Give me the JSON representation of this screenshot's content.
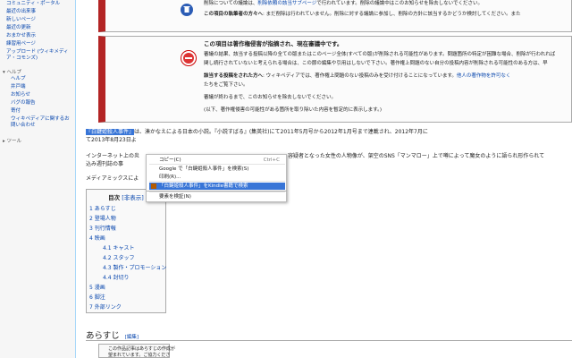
{
  "sidebar": {
    "items": [
      {
        "label": "コミュニティ・ポータル"
      },
      {
        "label": "最近の出来事"
      },
      {
        "label": "新しいページ"
      },
      {
        "label": "最近の更新"
      },
      {
        "label": "おまかせ表示"
      },
      {
        "label": "練習用ページ"
      },
      {
        "label": "アップロード (ウィキメディア・コモンズ)"
      }
    ],
    "help_heading": "ヘルプ",
    "help_items": [
      {
        "label": "ヘルプ"
      },
      {
        "label": "井戸端"
      },
      {
        "label": "お知らせ"
      },
      {
        "label": "バグの報告"
      },
      {
        "label": "寄付"
      },
      {
        "label": "ウィキペディアに関するお問い合わせ"
      }
    ],
    "tools_heading": "ツール"
  },
  "notice_top": {
    "line1a": "削除についての議論は、",
    "line1b": "削除依頼の該当サブページ",
    "line1c": "で行われています。削除の議論中はこのお知らせを除去しないでください。",
    "line2a": "この項目の執筆者の方々へ",
    "line2b": ": まだ削除は行われていません。削除に対する議論に参加し、削除の方針に該当するかどうか検討してください。また"
  },
  "notice_main": {
    "title": "この項目は著作権侵害が指摘され、現在審議中です。",
    "body1": "審議の結果、該当する投稿以降の全ての版またはこのページ全体(すべての版)が削除される可能性があります。問題箇所の特定が困難な場合、削除が行われれば",
    "body2": "関し続行されていないと考えられる場合は、この節の編集や引用はしないで下さい。著作権上問題のない自分の投稿内容が削除される可能性のある方は、早",
    "body3a": "該当する投稿をされた方へ",
    "body3b": ": ウィキペディアでは、著作権上問題のない投稿のみを受け付けることになっています。",
    "body3c": "他人の著作物を許可なく",
    "body4": "たちをご覧下さい。",
    "body5": "審議が終わるまで、このお知らせを除去しないでください。",
    "body6": "(以下、著作権侵害の可能性がある箇所を取り除いた内容を暫定的に表示します。)"
  },
  "article": {
    "selected": "『白鍵姫殺人事件』",
    "lead_tail": "は、湊かなえによる日本の小説。『小説すばる』(集英社)にて2011年5月号から2012年1月号まで連載され、2012年7月に",
    "line2": "て2013年8月23日よ",
    "line3a": "インターネット上の炎",
    "line3b": "容疑者となった女性の人物像が、架空のSNS「マンマロー」上で噂によって魔女のように語られ形作られて",
    "line4": "込み週刊誌の事",
    "line5": "メディアミックスによ"
  },
  "toc": {
    "title": "目次",
    "toggle": "[非表示]",
    "items": [
      {
        "label": "1 あらすじ"
      },
      {
        "label": "2 登場人物"
      },
      {
        "label": "3 刊行情報"
      },
      {
        "label": "4 映画"
      },
      {
        "label": "4.1 キャスト"
      },
      {
        "label": "4.2 スタッフ"
      },
      {
        "label": "4.3 製作・プロモーション"
      },
      {
        "label": "4.4 封切り"
      },
      {
        "label": "5 漫画"
      },
      {
        "label": "6 脚注"
      },
      {
        "label": "7 外部リンク"
      }
    ]
  },
  "section": {
    "heading": "あらすじ",
    "edit": "[編集]",
    "stub1": "この作品記事はあらすじの作成が",
    "stub2": "望まれています。ご協力くださ"
  },
  "context_menu": {
    "copy": "コピー(C)",
    "copy_shortcut": "Ctrl+C",
    "google_search": "Google で「白鍵姫殺人事件」を検索(S)",
    "print": "印刷(R)...",
    "kindle_search": "「白鍵姫殺人事件」をKindle書籍で検索",
    "inspect": "要素を検証(N)"
  },
  "colors": {
    "highlight": "#3875d7",
    "link": "#0645ad",
    "notice_border": "#b32424"
  }
}
